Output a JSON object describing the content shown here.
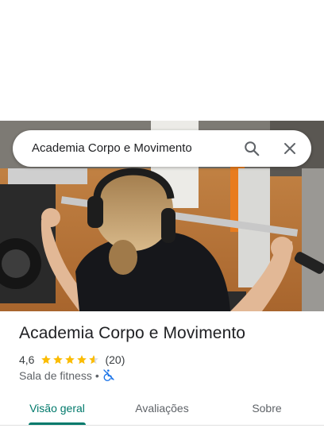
{
  "search": {
    "query": "Academia Corpo e Movimento",
    "search_icon": "search-icon",
    "close_icon": "close-icon"
  },
  "hero": {
    "description": "",
    "icon": "photo"
  },
  "place": {
    "name": "Academia Corpo e Movimento",
    "rating": "4,6",
    "rating_value": 4.6,
    "review_count": "(20)",
    "category": "Sala de fitness",
    "separator": "•",
    "accessibility_icon": "wheelchair-not-accessible-icon"
  },
  "tabs": [
    {
      "label": "Visão geral",
      "active": true
    },
    {
      "label": "Avaliações",
      "active": false
    },
    {
      "label": "Sobre",
      "active": false
    }
  ],
  "colors": {
    "accent": "#00796b",
    "star": "#fbbc04",
    "accessibility": "#1a73e8"
  }
}
